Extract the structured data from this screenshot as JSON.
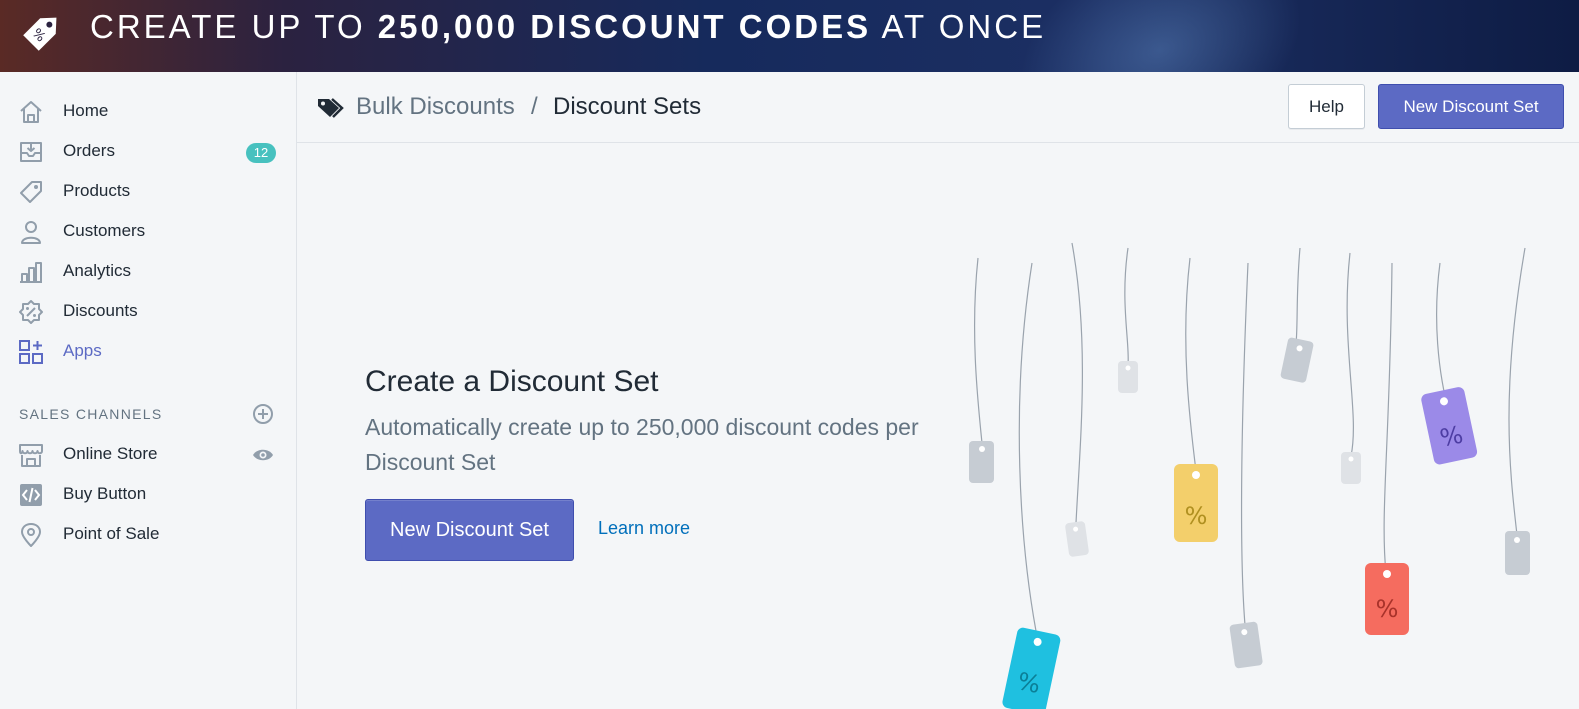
{
  "banner": {
    "text_pre": "CREATE UP TO ",
    "text_bold": "250,000 DISCOUNT CODES",
    "text_post": " AT ONCE",
    "logo_icon": "discount-tag-icon"
  },
  "sidebar": {
    "items": [
      {
        "label": "Home",
        "icon": "home-icon"
      },
      {
        "label": "Orders",
        "icon": "orders-icon",
        "badge": "12"
      },
      {
        "label": "Products",
        "icon": "tag-icon"
      },
      {
        "label": "Customers",
        "icon": "user-icon"
      },
      {
        "label": "Analytics",
        "icon": "bar-chart-icon"
      },
      {
        "label": "Discounts",
        "icon": "discount-icon"
      },
      {
        "label": "Apps",
        "icon": "apps-icon",
        "active": true
      }
    ],
    "sales_channels_title": "SALES CHANNELS",
    "channels": [
      {
        "label": "Online Store",
        "icon": "store-icon"
      },
      {
        "label": "Buy Button",
        "icon": "code-icon"
      },
      {
        "label": "Point of Sale",
        "icon": "location-pin-icon"
      }
    ]
  },
  "topbar": {
    "breadcrumb_app": "Bulk Discounts",
    "breadcrumb_sep": "/",
    "breadcrumb_page": "Discount Sets",
    "help_label": "Help",
    "new_set_label": "New Discount Set"
  },
  "empty_state": {
    "title": "Create a Discount Set",
    "description": "Automatically create up to 250,000 discount codes per Discount Set",
    "primary_label": "New Discount Set",
    "learn_more_label": "Learn more"
  },
  "illustration": {
    "tag_symbol": "%",
    "colors": {
      "cyan": "#1fc0e0",
      "yellow": "#f3cf6b",
      "purple": "#9b8ae8",
      "red": "#f56c5f",
      "grey": "#c6ccd3",
      "light_grey": "#dfe2e6"
    }
  },
  "colors": {
    "accent": "#5c6ac4",
    "link": "#006fbb",
    "badge": "#47c1bf",
    "text": "#212b36",
    "muted": "#637381"
  }
}
